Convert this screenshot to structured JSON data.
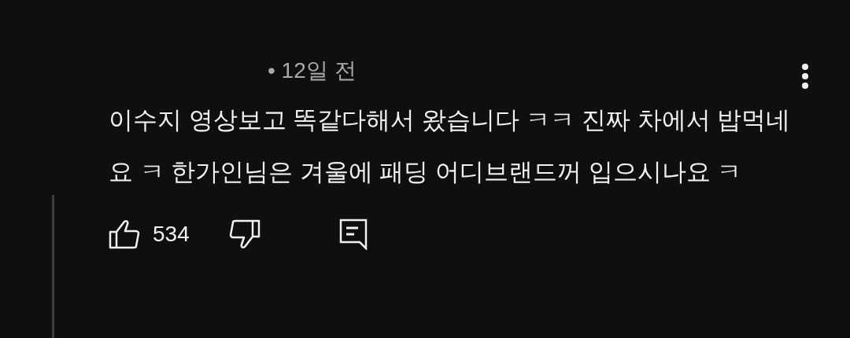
{
  "comment": {
    "time": "• 12일 전",
    "text": "이수지 영상보고 똑같다해서 왔습니다 ㅋㅋ 진짜 차에서 밥먹네요 ㅋ 한가인님은 겨울에 패딩 어디브랜드꺼 입으시나요 ㅋ",
    "like_count": "534"
  }
}
